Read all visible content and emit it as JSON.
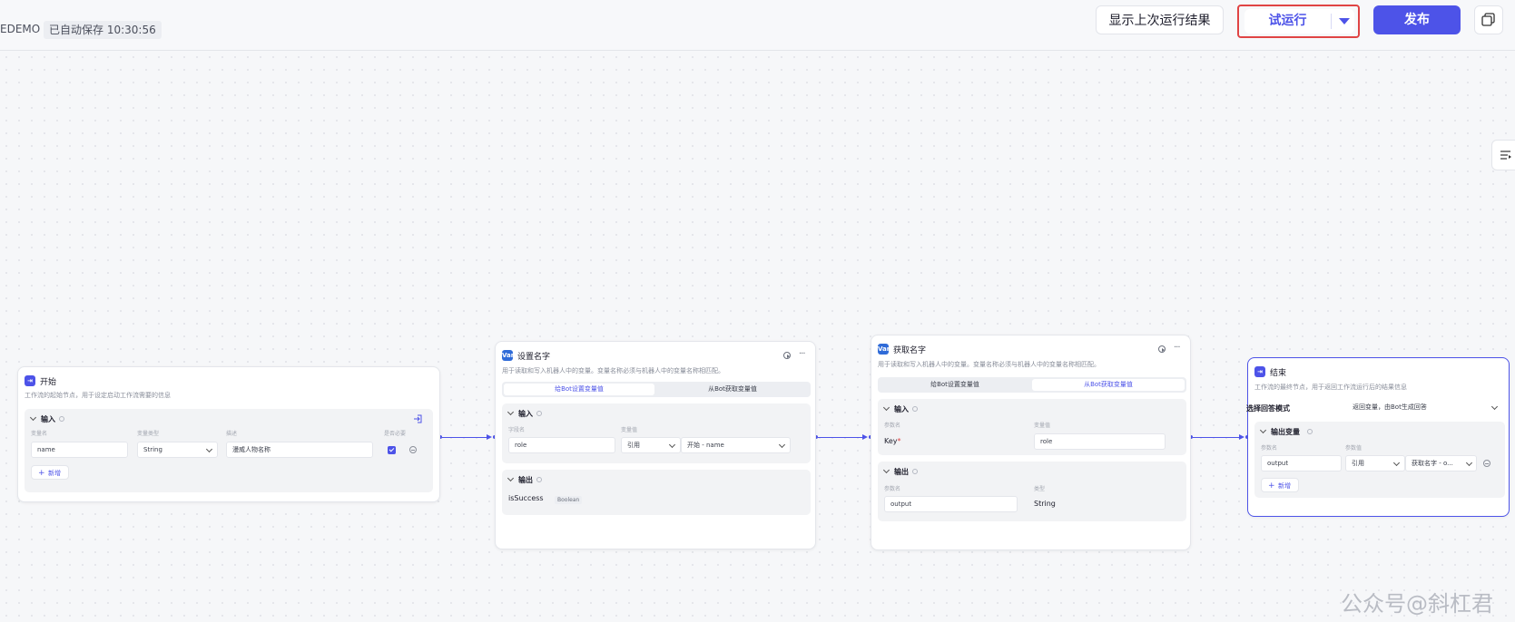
{
  "header": {
    "project_name": "EDEMO",
    "autosave": "已自动保存 10:30:56",
    "show_last_result": "显示上次运行结果",
    "test_run": "试运行",
    "publish": "发布"
  },
  "nodes": {
    "start": {
      "title": "开始",
      "desc": "工作流的起始节点，用于设定启动工作流需要的信息",
      "section_input": "输入",
      "col_name": "变量名",
      "col_type": "变量类型",
      "col_desc": "描述",
      "col_required": "是否必要",
      "row_name": "name",
      "row_type": "String",
      "row_desc": "漫威人物名称",
      "add": "新增"
    },
    "set_name": {
      "title": "设置名字",
      "desc": "用于读取和写入机器人中的变量。变量名称必须与机器人中的变量名称相匹配。",
      "tab_set": "给Bot设置变量值",
      "tab_get": "从Bot获取变量值",
      "section_input": "输入",
      "col_field": "字段名",
      "col_value": "变量值",
      "field_value": "role",
      "ref": "引用",
      "ref_value": "开始 - name",
      "section_output": "输出",
      "out_name": "isSuccess",
      "out_type": "Boolean"
    },
    "get_name": {
      "title": "获取名字",
      "desc": "用于读取和写入机器人中的变量。变量名称必须与机器人中的变量名称相匹配。",
      "tab_set": "给Bot设置变量值",
      "tab_get": "从Bot获取变量值",
      "section_input": "输入",
      "col_param": "参数名",
      "col_varval": "变量值",
      "key": "Key",
      "key_star": "*",
      "key_value": "role",
      "section_output": "输出",
      "out_col_param": "参数名",
      "out_col_type": "类型",
      "out_name": "output",
      "out_type": "String"
    },
    "end": {
      "title": "结束",
      "desc": "工作流的最终节点，用于返回工作流运行后的结果信息",
      "mode_label": "选择回答模式",
      "mode_value": "返回变量，由Bot生成回答",
      "section_output": "输出变量",
      "col_param": "参数名",
      "col_value": "参数值",
      "out_name": "output",
      "ref": "引用",
      "ref_value": "获取名字 - o...",
      "add": "新增"
    }
  },
  "watermark": "公众号@斜杠君",
  "colors": {
    "accent": "#4d53e8",
    "highlight": "#e04444"
  }
}
